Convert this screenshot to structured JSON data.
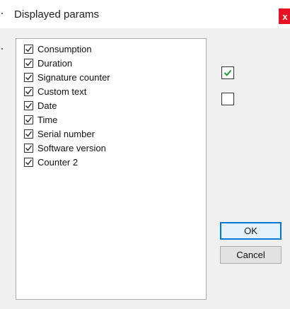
{
  "window": {
    "title": "Displayed params",
    "close_glyph": "x"
  },
  "params": [
    {
      "label": "Consumption",
      "checked": true
    },
    {
      "label": "Duration",
      "checked": true
    },
    {
      "label": "Signature counter",
      "checked": true
    },
    {
      "label": "Custom text",
      "checked": true
    },
    {
      "label": "Date",
      "checked": true
    },
    {
      "label": "Time",
      "checked": true
    },
    {
      "label": "Serial number",
      "checked": true
    },
    {
      "label": "Software version",
      "checked": true
    },
    {
      "label": "Counter 2",
      "checked": true
    }
  ],
  "select_all": {
    "checked": true,
    "icon": "green-check-icon"
  },
  "select_none": {
    "checked": false
  },
  "buttons": {
    "ok_label": "OK",
    "cancel_label": "Cancel"
  },
  "colors": {
    "close_button": "#e81123",
    "ok_border": "#0078d7",
    "select_all_check": "#1a9b2e"
  }
}
